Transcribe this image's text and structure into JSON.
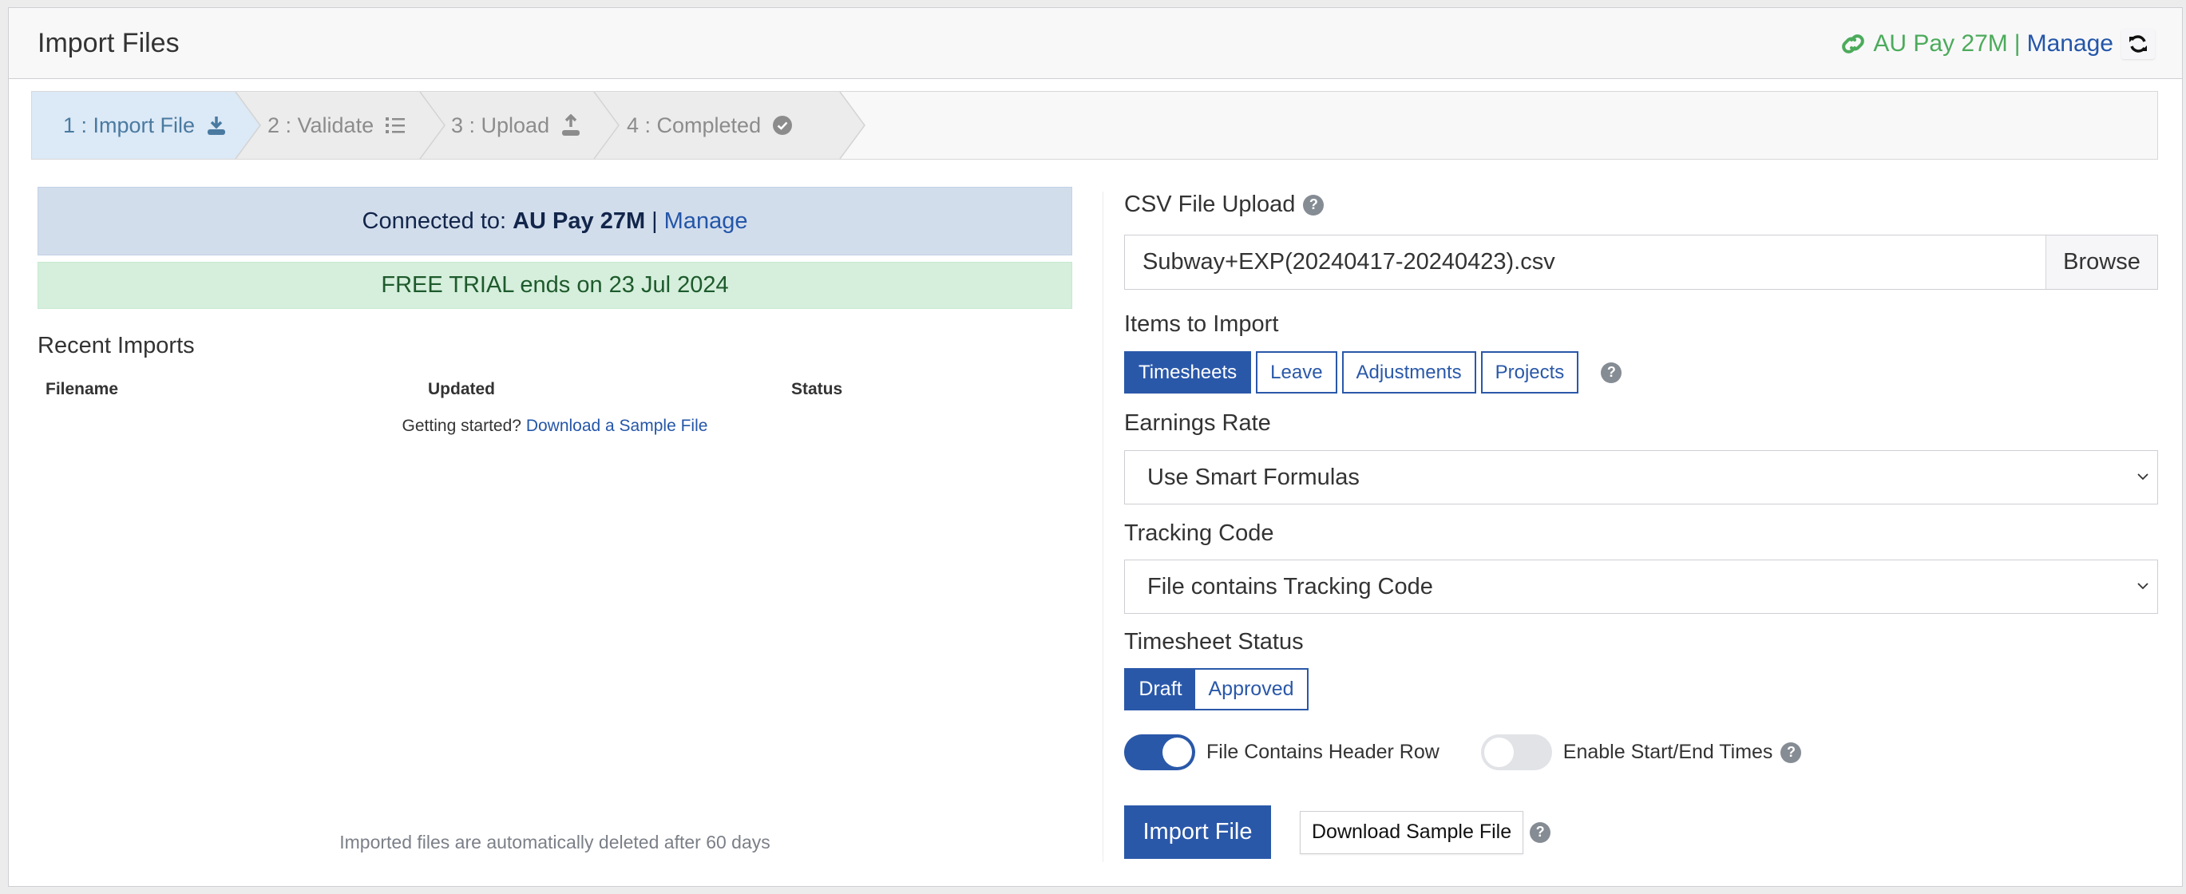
{
  "header": {
    "title": "Import Files",
    "connection_name": "AU Pay 27M",
    "separator": "|",
    "manage_label": "Manage",
    "link_icon": "link-icon",
    "refresh_icon": "refresh-icon"
  },
  "stepper": {
    "steps": [
      {
        "label": "1 : Import File",
        "icon": "download-icon",
        "active": true
      },
      {
        "label": "2 : Validate",
        "icon": "list-icon",
        "active": false
      },
      {
        "label": "3 : Upload",
        "icon": "upload-icon",
        "active": false
      },
      {
        "label": "4 : Completed",
        "icon": "check-circle-icon",
        "active": false
      }
    ]
  },
  "left": {
    "connected_prefix": "Connected to:",
    "connected_name": "AU Pay 27M",
    "connected_sep": "|",
    "connected_manage": "Manage",
    "trial_text": "FREE TRIAL ends on 23 Jul 2024",
    "recent_title": "Recent Imports",
    "columns": [
      "Filename",
      "Updated",
      "Status"
    ],
    "rows": [],
    "empty_prefix": "Getting started?",
    "empty_link": "Download a Sample File",
    "footnote": "Imported files are automatically deleted after 60 days"
  },
  "right": {
    "csv_label": "CSV File Upload",
    "csv_value": "Subway+EXP(20240417-20240423).csv",
    "browse_label": "Browse",
    "items_label": "Items to Import",
    "items": [
      {
        "label": "Timesheets",
        "selected": true
      },
      {
        "label": "Leave",
        "selected": false
      },
      {
        "label": "Adjustments",
        "selected": false
      },
      {
        "label": "Projects",
        "selected": false
      }
    ],
    "earnings_label": "Earnings Rate",
    "earnings_value": "Use Smart Formulas",
    "tracking_label": "Tracking Code",
    "tracking_value": "File contains Tracking Code",
    "status_label": "Timesheet Status",
    "status_options": [
      {
        "label": "Draft",
        "selected": true
      },
      {
        "label": "Approved",
        "selected": false
      }
    ],
    "header_row_toggle": {
      "label": "File Contains Header Row",
      "on": true
    },
    "start_end_toggle": {
      "label": "Enable Start/End Times",
      "on": false
    },
    "import_button": "Import File",
    "download_sample_button": "Download Sample File",
    "help_glyph": "?"
  },
  "colors": {
    "primary": "#2a58a9",
    "success_text": "#4cab5b",
    "info_bg": "#d2ddec",
    "success_bg": "#d5efdc",
    "step_active_bg": "#dce9f6"
  }
}
